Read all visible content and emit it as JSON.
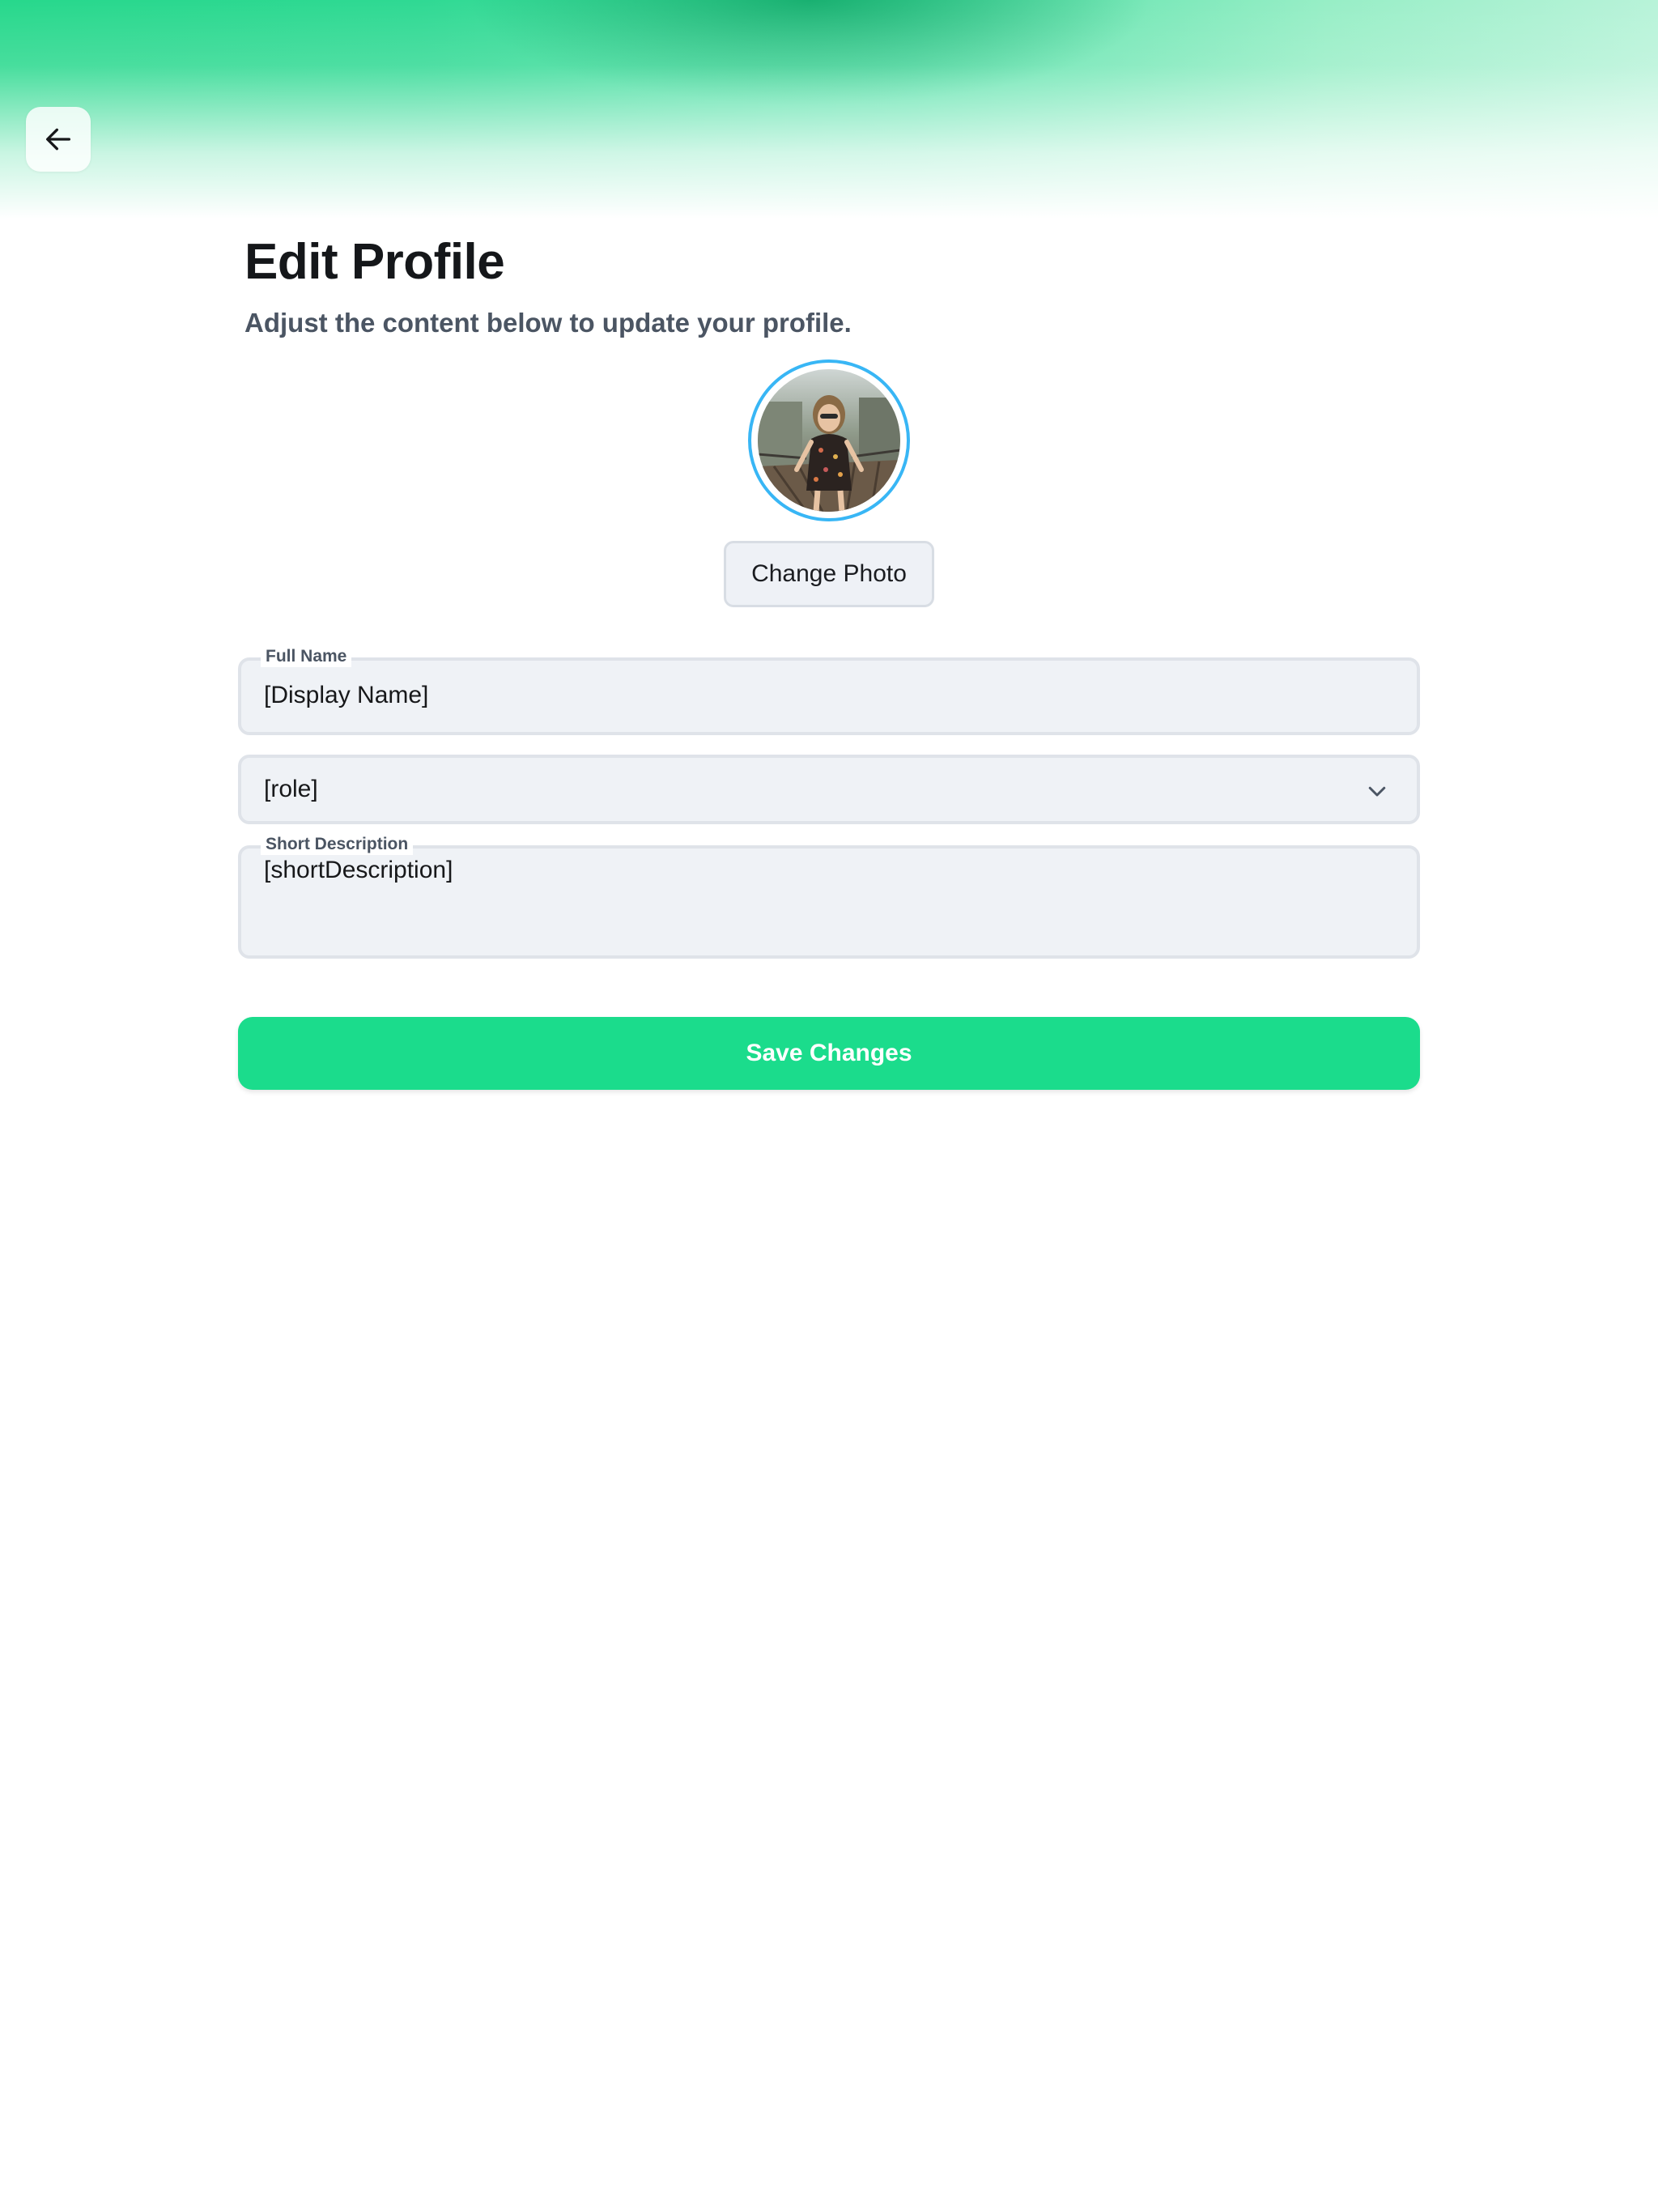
{
  "header": {
    "back_icon": "arrow-left-icon"
  },
  "page": {
    "title": "Edit Profile",
    "subtitle": "Adjust the content below to update your profile."
  },
  "profile_photo": {
    "change_label": "Change Photo",
    "ring_color": "#38b6f5"
  },
  "form": {
    "full_name": {
      "label": "Full Name",
      "value": "[Display Name]"
    },
    "role": {
      "value": "[role]",
      "icon": "chevron-down-icon"
    },
    "short_description": {
      "label": "Short Description",
      "value": "[shortDescription]"
    }
  },
  "actions": {
    "save_label": "Save Changes"
  },
  "colors": {
    "accent": "#1bdc8c",
    "header_green": "#27d88c",
    "muted_text": "#4b5563"
  }
}
